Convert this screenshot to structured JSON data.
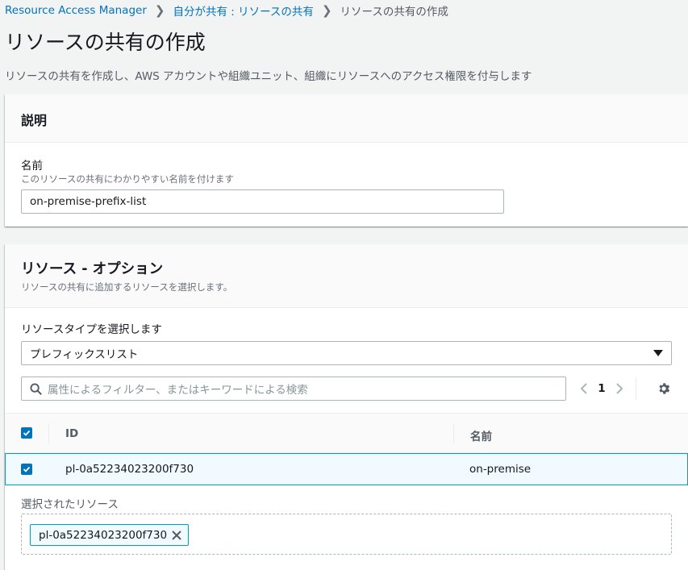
{
  "breadcrumb": {
    "root": "Resource Access Manager",
    "parent": "自分が共有 : リソースの共有",
    "current": "リソースの共有の作成"
  },
  "page": {
    "title": "リソースの共有の作成",
    "description": "リソースの共有を作成し、AWS アカウントや組織ユニット、組織にリソースへのアクセス権限を付与します"
  },
  "description_panel": {
    "title": "説明",
    "name_label": "名前",
    "name_hint": "このリソースの共有にわかりやすい名前を付けます",
    "name_value": "on-premise-prefix-list"
  },
  "resources_panel": {
    "title": "リソース - オプション",
    "subtitle": "リソースの共有に追加するリソースを選択します。",
    "type_label": "リソースタイプを選択します",
    "type_value": "プレフィックスリスト",
    "filter_placeholder": "属性によるフィルター、またはキーワードによる検索",
    "page_number": "1",
    "table": {
      "columns": [
        "ID",
        "名前"
      ],
      "rows": [
        {
          "id": "pl-0a52234023200f730",
          "name": "on-premise",
          "selected": true
        }
      ]
    },
    "selected_label": "選択されたリソース",
    "selected_tokens": [
      "pl-0a52234023200f730"
    ]
  },
  "colors": {
    "link": "#0073bb",
    "selection_border": "#00a1c9",
    "selection_bg": "#f1faff"
  }
}
